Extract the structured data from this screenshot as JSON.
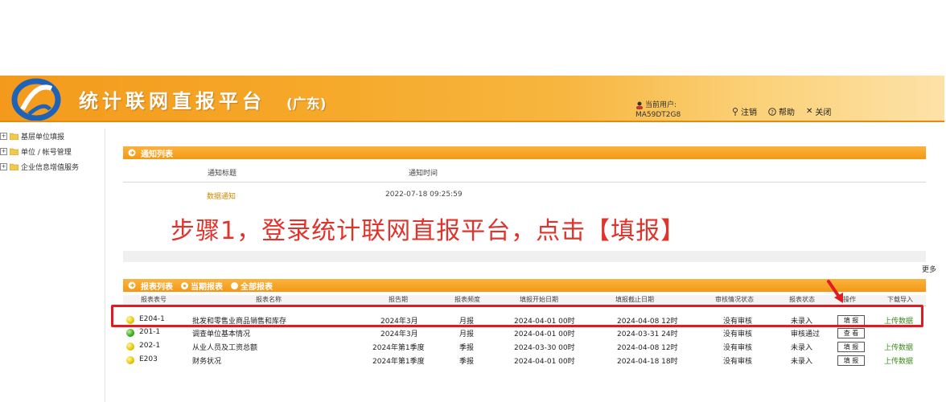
{
  "header": {
    "title": "统计联网直报平台",
    "region": "(广东)",
    "user_label": "当前用户:",
    "user_id": "MA59DT2G8",
    "links": [
      {
        "label": "注销",
        "icon": "key-icon"
      },
      {
        "label": "帮助",
        "icon": "help-icon"
      },
      {
        "label": "关闭",
        "icon": "close-icon"
      }
    ]
  },
  "leftnav": {
    "items": [
      {
        "expander": "+",
        "label": "基层单位填报"
      },
      {
        "expander": "+",
        "label": "单位 / 帐号管理"
      },
      {
        "expander": "+",
        "label": "企业信息增值服务"
      }
    ]
  },
  "notice": {
    "section_title": "通知列表",
    "col_title": "通知标题",
    "col_time": "通知时间",
    "row_title": "数据通知",
    "row_time": "2022-07-18 09:25:59",
    "more": "更多"
  },
  "annotation": "步骤1，登录统计联网直报平台，点击【填报】",
  "reports": {
    "section_title": "报表列表",
    "tabs": [
      {
        "label": "当期报表",
        "selected": true
      },
      {
        "label": "全部报表",
        "selected": false
      }
    ],
    "columns": [
      "报表表号",
      "报表名称",
      "报告期",
      "报表频度",
      "填报开始日期",
      "填报截止日期",
      "审核情况状态",
      "报表状态",
      "操作",
      "下载导入"
    ],
    "rows": [
      {
        "status": "yellow",
        "code": "E204-1",
        "name": "批发和零售业商品销售和库存",
        "period": "2024年3月",
        "freq": "月报",
        "start": "2024-04-01 00时",
        "end": "2024-04-08 12时",
        "audit": "没有审核",
        "state": "未录入",
        "action": "填 报",
        "download": "上传数据"
      },
      {
        "status": "green",
        "code": "201-1",
        "name": "调查单位基本情况",
        "period": "2024年3月",
        "freq": "月报",
        "start": "2024-04-01 00时",
        "end": "2024-03-31 24时",
        "audit": "没有审核",
        "state": "审核通过",
        "action": "查 看",
        "download": ""
      },
      {
        "status": "yellow",
        "code": "202-1",
        "name": "从业人员及工资总额",
        "period": "2024年第1季度",
        "freq": "季报",
        "start": "2024-03-30 00时",
        "end": "2024-04-08 12时",
        "audit": "没有审核",
        "state": "未录入",
        "action": "填 报",
        "download": "上传数据"
      },
      {
        "status": "yellow",
        "code": "E203",
        "name": "财务状况",
        "period": "2024年第1季度",
        "freq": "季报",
        "start": "2024-04-01 00时",
        "end": "2024-04-18 18时",
        "audit": "没有审核",
        "state": "未录入",
        "action": "填 报",
        "download": "上传数据"
      }
    ]
  },
  "colors": {
    "banner": "#f39a1c",
    "section": "#f39816",
    "highlight": "#e21b22",
    "annotation": "#e0332b"
  }
}
